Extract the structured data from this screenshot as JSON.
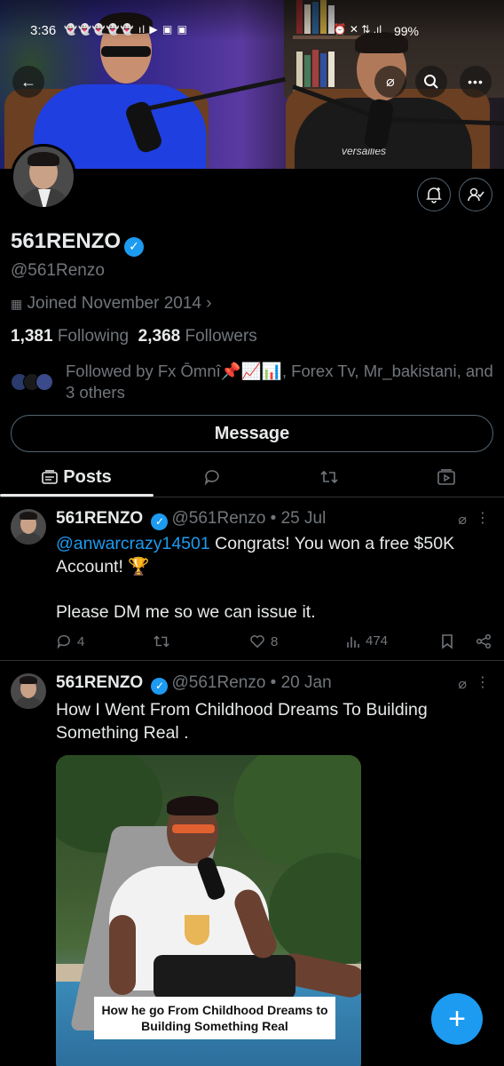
{
  "status_bar": {
    "time": "3:36",
    "battery": "99%"
  },
  "header": {
    "back_icon": "arrow-left-icon",
    "grok_icon": "grok-icon",
    "search_icon": "search-icon",
    "more_icon": "more-dots-icon"
  },
  "profile": {
    "display_name": "561RENZO",
    "handle": "@561Renzo",
    "joined": "Joined November 2014",
    "following_count": "1,381",
    "following_label": "Following",
    "followers_count": "2,368",
    "followers_label": "Followers",
    "followed_by": "Followed by Fx Ōmnî📌📈📊, Forex Tv, Mr_bakistani, and 3 others",
    "message_label": "Message"
  },
  "tabs": [
    {
      "label": "Posts",
      "icon": "posts-icon"
    },
    {
      "label": "",
      "icon": "replies-icon"
    },
    {
      "label": "",
      "icon": "reposts-icon"
    },
    {
      "label": "",
      "icon": "media-icon"
    }
  ],
  "posts": [
    {
      "name": "561RENZO",
      "handle_date": "@561Renzo • 25 Jul",
      "mention": "@anwarcrazy14501",
      "text_1": " Congrats! You won a free $50K Account! 🏆",
      "text_2": "Please DM me so we can issue it.",
      "replies": "4",
      "reposts": "",
      "likes": "8",
      "views": "474"
    },
    {
      "name": "561RENZO",
      "handle_date": "@561Renzo • 20 Jan",
      "text_1": "How I Went From Childhood Dreams To Building Something Real .",
      "media_caption": "How he go From Childhood Dreams to Building Something Real"
    }
  ],
  "colors": {
    "accent": "#1d9bf0",
    "background": "#000000",
    "secondary_text": "#71767b",
    "border": "#2f3336"
  }
}
